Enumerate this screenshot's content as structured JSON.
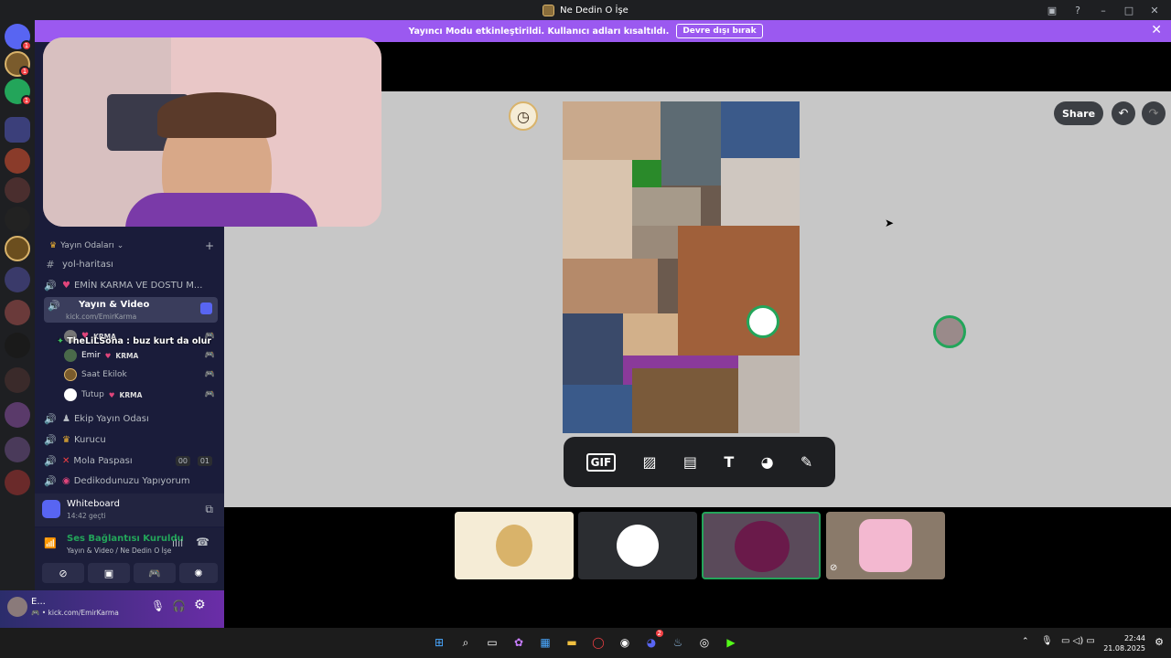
{
  "window": {
    "title": "Ne Dedin O İşe"
  },
  "banner": {
    "text": "Yayıncı Modu etkinleştirildi. Kullanıcı adları kısaltıldı.",
    "button": "Devre dışı bırak"
  },
  "servers": {
    "badges": [
      "1",
      "1",
      "1"
    ]
  },
  "sidebar": {
    "category": "Yayın Odaları",
    "channels": [
      {
        "name": "yol-haritası",
        "icon": "hash-icon"
      },
      {
        "name": "EMİN KARMA VE DOSTU M...",
        "icon": "speaker-icon"
      },
      {
        "name": "Yayın & Video",
        "icon": "speaker-icon",
        "sub": "kick.com/EmirKarma"
      },
      {
        "name": "Ekip Yayın Odası",
        "icon": "speaker-icon"
      },
      {
        "name": "Kurucu",
        "icon": "speaker-icon"
      },
      {
        "name": "Mola Paspası",
        "icon": "speaker-icon",
        "counts": [
          "00",
          "01"
        ]
      },
      {
        "name": "Dedikodunuzu Yapıyorum",
        "icon": "speaker-icon"
      }
    ],
    "voice_users": [
      {
        "name": "KRMA",
        "tag": ""
      },
      {
        "name": "Emir",
        "tag": "KRMA"
      },
      {
        "name": "Saat Ekilok",
        "tag": ""
      },
      {
        "name": "Tutup",
        "tag": "KRMA"
      }
    ],
    "overlay_chat": "TheLiLSona : buz kurt da olur"
  },
  "whiteboard": {
    "title": "Whiteboard",
    "time": "14:42 geçti"
  },
  "voice": {
    "status": "Ses Bağlantısı Kuruldu",
    "path": "Yayın & Video / Ne Dedin O İşe"
  },
  "user_panel": {
    "name": "E...",
    "status": "• kick.com/EmirKarma"
  },
  "canvas": {
    "share": "Share",
    "tools": [
      "GIF"
    ]
  },
  "taskbar": {
    "time": "22:44",
    "date": "21.08.2025",
    "badge": "2"
  },
  "colors": {
    "accent": "#9b59f0",
    "sidebar": "#1a1c3a",
    "canvas": "#c7c7c7"
  }
}
